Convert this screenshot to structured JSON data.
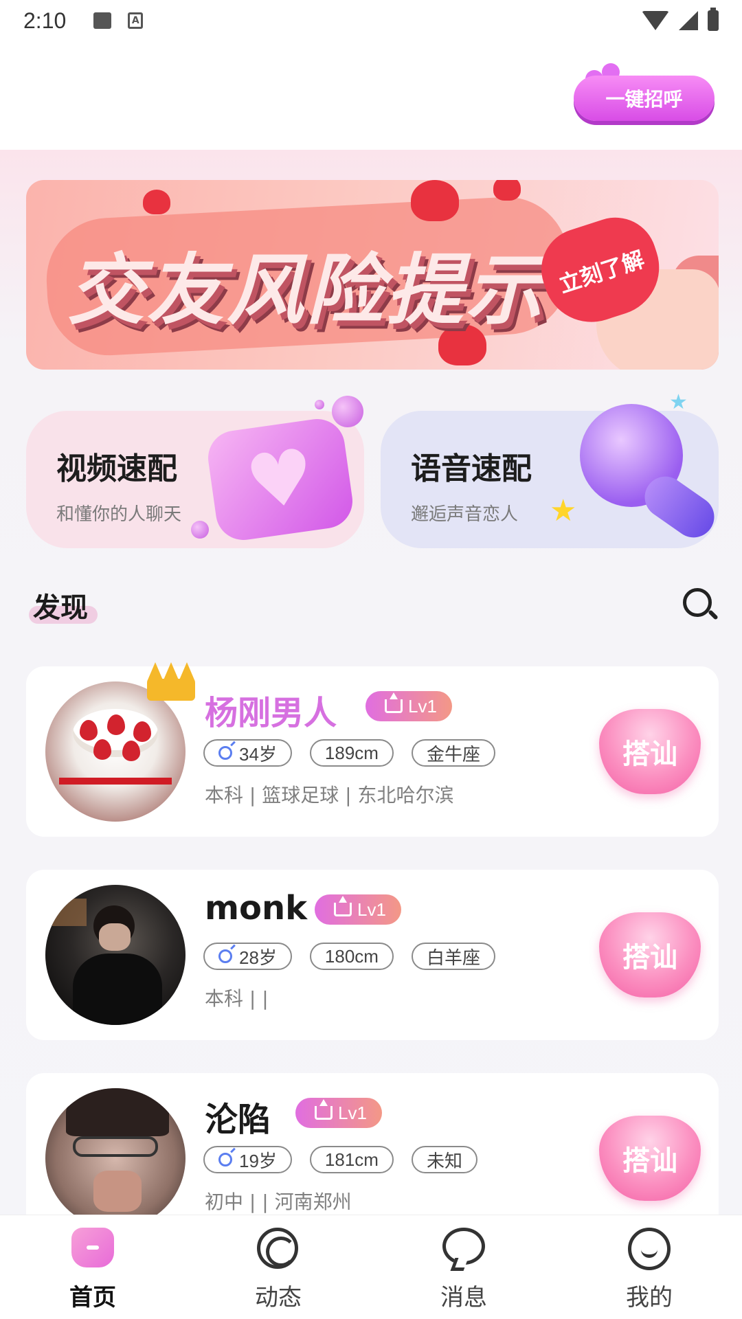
{
  "status_bar": {
    "time": "2:10"
  },
  "header": {
    "greet_button_label": "一键招呼"
  },
  "banner": {
    "title": "交友风险提示",
    "cta": "立刻了解"
  },
  "quick_match": [
    {
      "title": "视频速配",
      "subtitle": "和懂你的人聊天"
    },
    {
      "title": "语音速配",
      "subtitle": "邂逅声音恋人"
    }
  ],
  "discover": {
    "title": "发现"
  },
  "users": [
    {
      "name": "杨刚男人",
      "level": "Lv1",
      "age": "34岁",
      "height": "189cm",
      "zodiac": "金牛座",
      "desc": "本科 | 篮球足球 | 东北哈尔滨",
      "action": "搭讪"
    },
    {
      "name": "monk",
      "level": "Lv1",
      "age": "28岁",
      "height": "180cm",
      "zodiac": "白羊座",
      "desc": "本科 | |",
      "action": "搭讪"
    },
    {
      "name": "沦陷",
      "level": "Lv1",
      "age": "19岁",
      "height": "181cm",
      "zodiac": "未知",
      "desc": "初中 | | 河南郑州",
      "action": "搭讪"
    }
  ],
  "bottom_nav": [
    {
      "label": "首页",
      "icon": "home-icon",
      "active": true
    },
    {
      "label": "动态",
      "icon": "moments-icon",
      "active": false
    },
    {
      "label": "消息",
      "icon": "message-icon",
      "active": false
    },
    {
      "label": "我的",
      "icon": "profile-icon",
      "active": false
    }
  ],
  "colors": {
    "accent_pink": "#d670e0",
    "badge_gradient_start": "#e06ee0",
    "badge_gradient_end": "#f39886",
    "video_card_bg": "#f9e2ea",
    "voice_card_bg": "#e3e4f6"
  }
}
